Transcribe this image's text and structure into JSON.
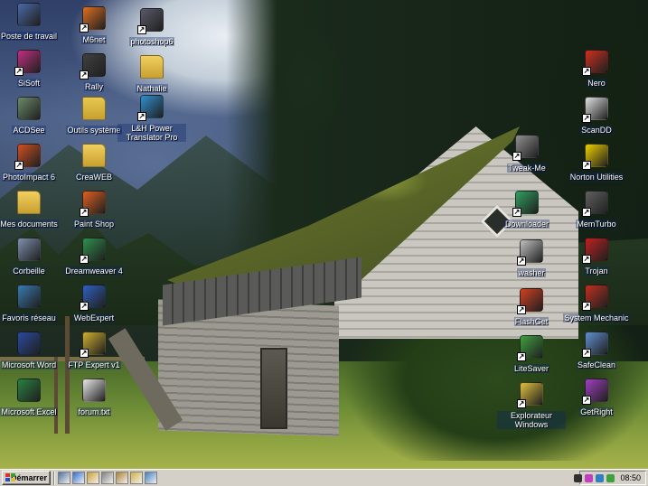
{
  "desktop": {
    "icons": [
      {
        "label": "Poste de travail",
        "icon": "my-computer-icon",
        "color": "#4a6aa8"
      },
      {
        "label": "SiSoft",
        "icon": "sisoft-icon",
        "color": "#c03080"
      },
      {
        "label": "ACDSee",
        "icon": "acdsee-icon",
        "color": "#6a8a6a"
      },
      {
        "label": "PhotoImpact 6",
        "icon": "photoimpact-icon",
        "color": "#d05020"
      },
      {
        "label": "Mes documents",
        "icon": "folder-icon",
        "color": "#f0d060"
      },
      {
        "label": "Corbeille",
        "icon": "recycle-bin-icon",
        "color": "#8090b0"
      },
      {
        "label": "Favoris réseau",
        "icon": "network-icon",
        "color": "#3a7ab0"
      },
      {
        "label": "Microsoft Word",
        "icon": "word-icon",
        "color": "#2a4aa0"
      },
      {
        "label": "Microsoft Excel",
        "icon": "excel-icon",
        "color": "#2a8040"
      },
      {
        "label": "M6net",
        "icon": "m6net-icon",
        "color": "#e07020"
      },
      {
        "label": "Rally",
        "icon": "rally-icon",
        "color": "#404040"
      },
      {
        "label": "Outils système",
        "icon": "system-tools-folder-icon",
        "color": "#e8c850"
      },
      {
        "label": "CreaWEB",
        "icon": "folder-icon",
        "color": "#f0d060"
      },
      {
        "label": "Paint Shop",
        "icon": "paint-shop-icon",
        "color": "#e06020"
      },
      {
        "label": "Dreamweaver 4",
        "icon": "dreamweaver-icon",
        "color": "#309050"
      },
      {
        "label": "WebExpert",
        "icon": "webexpert-icon",
        "color": "#3060c0"
      },
      {
        "label": "FTP Expert v1",
        "icon": "ftp-icon",
        "color": "#d0b030"
      },
      {
        "label": "forum.txt",
        "icon": "text-file-icon",
        "color": "#e8e8e8"
      },
      {
        "label": "photoshop6",
        "icon": "photoshop-icon",
        "color": "#5a5a6a"
      },
      {
        "label": "Nathalie",
        "icon": "folder-icon",
        "color": "#f0d060"
      },
      {
        "label": "L&H Power Translator Pro",
        "icon": "globe-icon",
        "color": "#3090d0"
      },
      {
        "label": "Nero",
        "icon": "nero-icon",
        "color": "#d03020"
      },
      {
        "label": "ScanDD",
        "icon": "scandisk-icon",
        "color": "#e0e0e0"
      },
      {
        "label": "Norton Utilities",
        "icon": "norton-icon",
        "color": "#f0d000"
      },
      {
        "label": "MemTurbo",
        "icon": "memory-chip-icon",
        "color": "#606060"
      },
      {
        "label": "Trojan",
        "icon": "trojan-icon",
        "color": "#c02020"
      },
      {
        "label": "System Mechanic",
        "icon": "toolbox-icon",
        "color": "#c03020"
      },
      {
        "label": "SafeClean",
        "icon": "safeclean-icon",
        "color": "#6090d0"
      },
      {
        "label": "GetRight",
        "icon": "getright-icon",
        "color": "#a040c0"
      },
      {
        "label": "Tweak-Me",
        "icon": "tweak-icon",
        "color": "#909090"
      },
      {
        "label": "Downloader",
        "icon": "downloader-icon",
        "color": "#30a060"
      },
      {
        "label": "washer",
        "icon": "washer-icon",
        "color": "#c0c0c0"
      },
      {
        "label": "FlashGet",
        "icon": "flashget-icon",
        "color": "#d04020"
      },
      {
        "label": "LiteSaver",
        "icon": "litesaver-icon",
        "color": "#40a040"
      },
      {
        "label": "Explorateur Windows",
        "icon": "explorer-icon",
        "color": "#e0c040"
      }
    ]
  },
  "taskbar": {
    "start_label": "Démarrer",
    "quick_launch": [
      {
        "icon": "show-desktop-icon",
        "color": "#5070a0"
      },
      {
        "icon": "internet-explorer-icon",
        "color": "#3070d0"
      },
      {
        "icon": "outlook-express-icon",
        "color": "#d0a030"
      },
      {
        "icon": "calculator-icon",
        "color": "#808080"
      },
      {
        "icon": "winamp-icon",
        "color": "#b08030"
      },
      {
        "icon": "explorer-quick-icon",
        "color": "#d0b040"
      },
      {
        "icon": "control-panel-icon",
        "color": "#4080c0"
      }
    ],
    "tray_icons": [
      {
        "icon": "volume-icon",
        "color": "#303030"
      },
      {
        "icon": "color-wheel-icon",
        "color": "#c040c0"
      },
      {
        "icon": "network-tray-icon",
        "color": "#3080c0"
      },
      {
        "icon": "antivirus-tray-icon",
        "color": "#40a040"
      }
    ],
    "clock": "08:50"
  }
}
